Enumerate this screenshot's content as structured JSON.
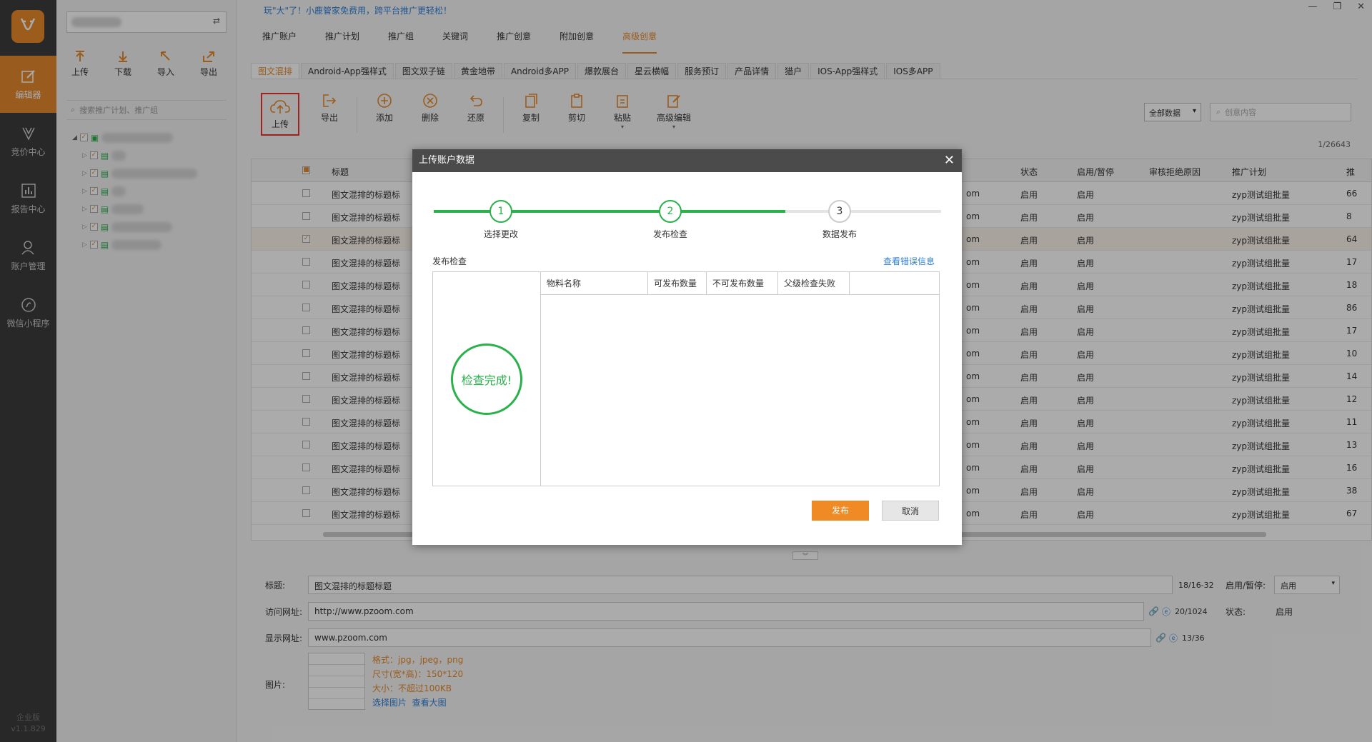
{
  "nav": {
    "items": [
      {
        "label": "编辑器",
        "icon": "edit-icon"
      },
      {
        "label": "竞价中心",
        "icon": "bid-icon"
      },
      {
        "label": "报告中心",
        "icon": "report-icon"
      },
      {
        "label": "账户管理",
        "icon": "user-icon"
      },
      {
        "label": "微信小程序",
        "icon": "miniprogram-icon"
      }
    ],
    "edition": "企业版",
    "version": "v1.1.829"
  },
  "sidebar": {
    "tools": [
      {
        "label": "上传"
      },
      {
        "label": "下载"
      },
      {
        "label": "导入"
      },
      {
        "label": "导出"
      }
    ],
    "search_placeholder": "搜索推广计划、推广组"
  },
  "banner": "玩\"大\"了！小鹿管家免费用，跨平台推广更轻松！",
  "top_tabs": [
    "推广账户",
    "推广计划",
    "推广组",
    "关键词",
    "推广创意",
    "附加创意",
    "高级创意"
  ],
  "sub_tabs": [
    "图文混排",
    "Android-App强样式",
    "图文双子链",
    "黄金地带",
    "Android多APP",
    "爆款展台",
    "星云横幅",
    "服务预订",
    "产品详情",
    "猎户",
    "IOS-App强样式",
    "IOS多APP"
  ],
  "toolbar": {
    "buttons": [
      {
        "label": "上传"
      },
      {
        "label": "导出"
      },
      {
        "label": "添加"
      },
      {
        "label": "删除"
      },
      {
        "label": "还原"
      },
      {
        "label": "复制"
      },
      {
        "label": "剪切"
      },
      {
        "label": "粘贴"
      },
      {
        "label": "高级编辑"
      }
    ],
    "filter_value": "全部数据",
    "search_placeholder": "创意内容",
    "count": "1/26643"
  },
  "grid": {
    "headers": {
      "title": "标题",
      "status": "状态",
      "enable": "启用/暂停",
      "reject": "审核拒绝原因",
      "plan": "推广计划",
      "extra": "推"
    },
    "rows": [
      {
        "title": "图文混排的标题标",
        "url": "om",
        "status": "启用",
        "enable": "启用",
        "plan": "zyp测试组批量",
        "extra": "66"
      },
      {
        "title": "图文混排的标题标",
        "url": "om",
        "status": "启用",
        "enable": "启用",
        "plan": "zyp测试组批量",
        "extra": "8"
      },
      {
        "title": "图文混排的标题标",
        "url": "om",
        "status": "启用",
        "enable": "启用",
        "plan": "zyp测试组批量",
        "extra": "64"
      },
      {
        "title": "图文混排的标题标",
        "url": "om",
        "status": "启用",
        "enable": "启用",
        "plan": "zyp测试组批量",
        "extra": "17"
      },
      {
        "title": "图文混排的标题标",
        "url": "om",
        "status": "启用",
        "enable": "启用",
        "plan": "zyp测试组批量",
        "extra": "18"
      },
      {
        "title": "图文混排的标题标",
        "url": "om",
        "status": "启用",
        "enable": "启用",
        "plan": "zyp测试组批量",
        "extra": "86"
      },
      {
        "title": "图文混排的标题标",
        "url": "om",
        "status": "启用",
        "enable": "启用",
        "plan": "zyp测试组批量",
        "extra": "17"
      },
      {
        "title": "图文混排的标题标",
        "url": "om",
        "status": "启用",
        "enable": "启用",
        "plan": "zyp测试组批量",
        "extra": "10"
      },
      {
        "title": "图文混排的标题标",
        "url": "om",
        "status": "启用",
        "enable": "启用",
        "plan": "zyp测试组批量",
        "extra": "14"
      },
      {
        "title": "图文混排的标题标",
        "url": "om",
        "status": "启用",
        "enable": "启用",
        "plan": "zyp测试组批量",
        "extra": "12"
      },
      {
        "title": "图文混排的标题标",
        "url": "om",
        "status": "启用",
        "enable": "启用",
        "plan": "zyp测试组批量",
        "extra": "11"
      },
      {
        "title": "图文混排的标题标",
        "url": "om",
        "status": "启用",
        "enable": "启用",
        "plan": "zyp测试组批量",
        "extra": "13"
      },
      {
        "title": "图文混排的标题标",
        "url": "om",
        "status": "启用",
        "enable": "启用",
        "plan": "zyp测试组批量",
        "extra": "16"
      },
      {
        "title": "图文混排的标题标",
        "url": "om",
        "status": "启用",
        "enable": "启用",
        "plan": "zyp测试组批量",
        "extra": "38"
      },
      {
        "title": "图文混排的标题标",
        "url": "om",
        "status": "启用",
        "enable": "启用",
        "plan": "zyp测试组批量",
        "extra": "67"
      }
    ]
  },
  "editor": {
    "title_label": "标题:",
    "title_value": "图文混排的标题标题",
    "title_count": "18/16-32",
    "visit_label": "访问网址:",
    "visit_value": "http://www.pzoom.com",
    "visit_count": "20/1024",
    "display_label": "显示网址:",
    "display_value": "www.pzoom.com",
    "display_count": "13/36",
    "image_label": "图片:",
    "hint_format": "格式：jpg，jpeg，png",
    "hint_size": "尺寸(宽*高)：150*120",
    "hint_filesize": "大小：不超过100KB",
    "select_image": "选择图片",
    "view_large": "查看大图",
    "enable_label": "启用/暂停:",
    "enable_value": "启用",
    "state_label": "状态:",
    "state_value": "启用"
  },
  "dialog": {
    "title": "上传账户数据",
    "steps": [
      {
        "num": "1",
        "label": "选择更改"
      },
      {
        "num": "2",
        "label": "发布检查"
      },
      {
        "num": "3",
        "label": "数据发布"
      }
    ],
    "section": "发布检查",
    "error_link": "查看错误信息",
    "result": "检查完成!",
    "columns": [
      "物料名称",
      "可发布数量",
      "不可发布数量",
      "父级检查失败"
    ],
    "publish": "发布",
    "cancel": "取消"
  },
  "colors": {
    "accent": "#e68a2e",
    "success": "#2ab14b",
    "link": "#2f7fd9"
  }
}
